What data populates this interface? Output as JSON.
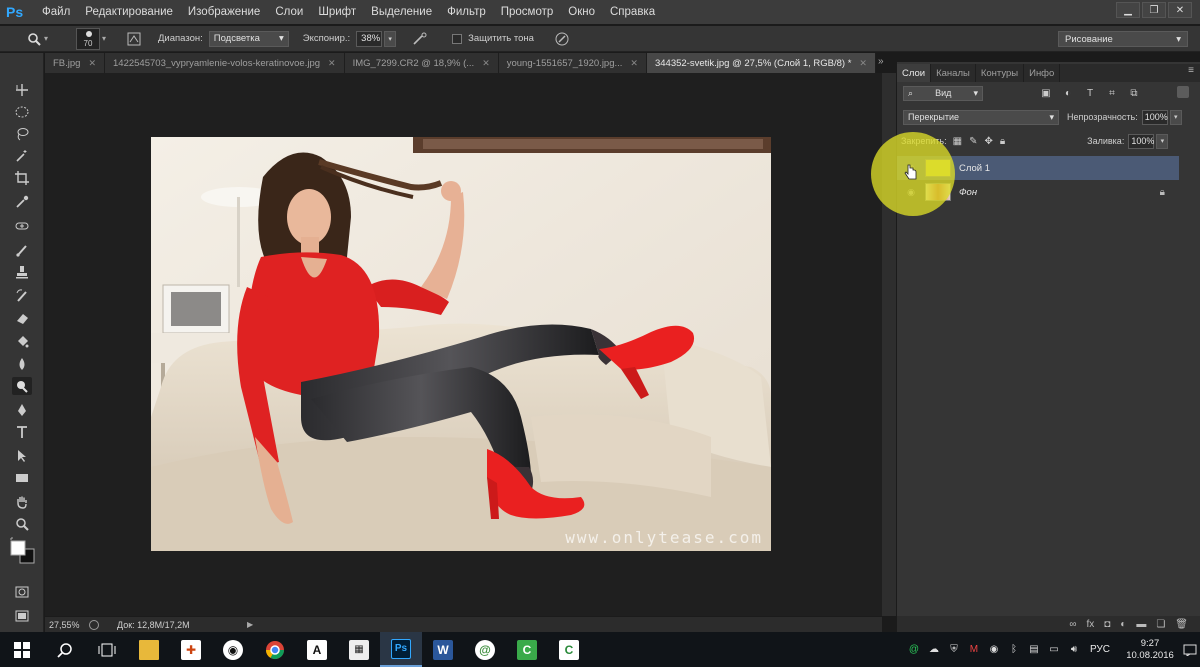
{
  "menubar": {
    "logo": "Ps",
    "items": [
      "Файл",
      "Редактирование",
      "Изображение",
      "Слои",
      "Шрифт",
      "Выделение",
      "Фильтр",
      "Просмотр",
      "Окно",
      "Справка"
    ]
  },
  "options": {
    "brush_size": "70",
    "range_label": "Диапазон:",
    "range_value": "Подсветка",
    "exposure_label": "Экспонир.:",
    "exposure_value": "38%",
    "protect_label": "Защитить тона",
    "workspace": "Рисование"
  },
  "tabs": [
    {
      "label": "FB.jpg"
    },
    {
      "label": "1422545703_vypryamlenie-volos-keratinovoe.jpg"
    },
    {
      "label": "IMG_7299.CR2 @ 18,9% (..."
    },
    {
      "label": "young-1551657_1920.jpg..."
    },
    {
      "label": "344352-svetik.jpg @ 27,5% (Слой 1, RGB/8) *"
    }
  ],
  "canvas": {
    "watermark": "www.onlytease.com"
  },
  "status": {
    "zoom": "27,55%",
    "doc": "Док: 12,8M/17,2M"
  },
  "layers_panel": {
    "tabs": [
      "Слои",
      "Каналы",
      "Контуры",
      "Инфо"
    ],
    "filter_kind": "Вид",
    "blend_mode": "Перекрытие",
    "opacity_label": "Непрозрачность:",
    "opacity_value": "100%",
    "lock_label": "Закрепить:",
    "fill_label": "Заливка:",
    "fill_value": "100%",
    "layers": [
      {
        "name": "Слой 1",
        "thumb_color": "#d8d83a",
        "selected": true
      },
      {
        "name": "Фон",
        "thumb_color": "#c96a5a",
        "selected": false
      }
    ]
  },
  "taskbar": {
    "lang": "РУС",
    "time": "9:27",
    "date": "10.08.2016"
  },
  "colors": {
    "accent_ps": "#31a8ff",
    "selected_layer": "#4b5a75",
    "highlight": "#dcdc28"
  }
}
